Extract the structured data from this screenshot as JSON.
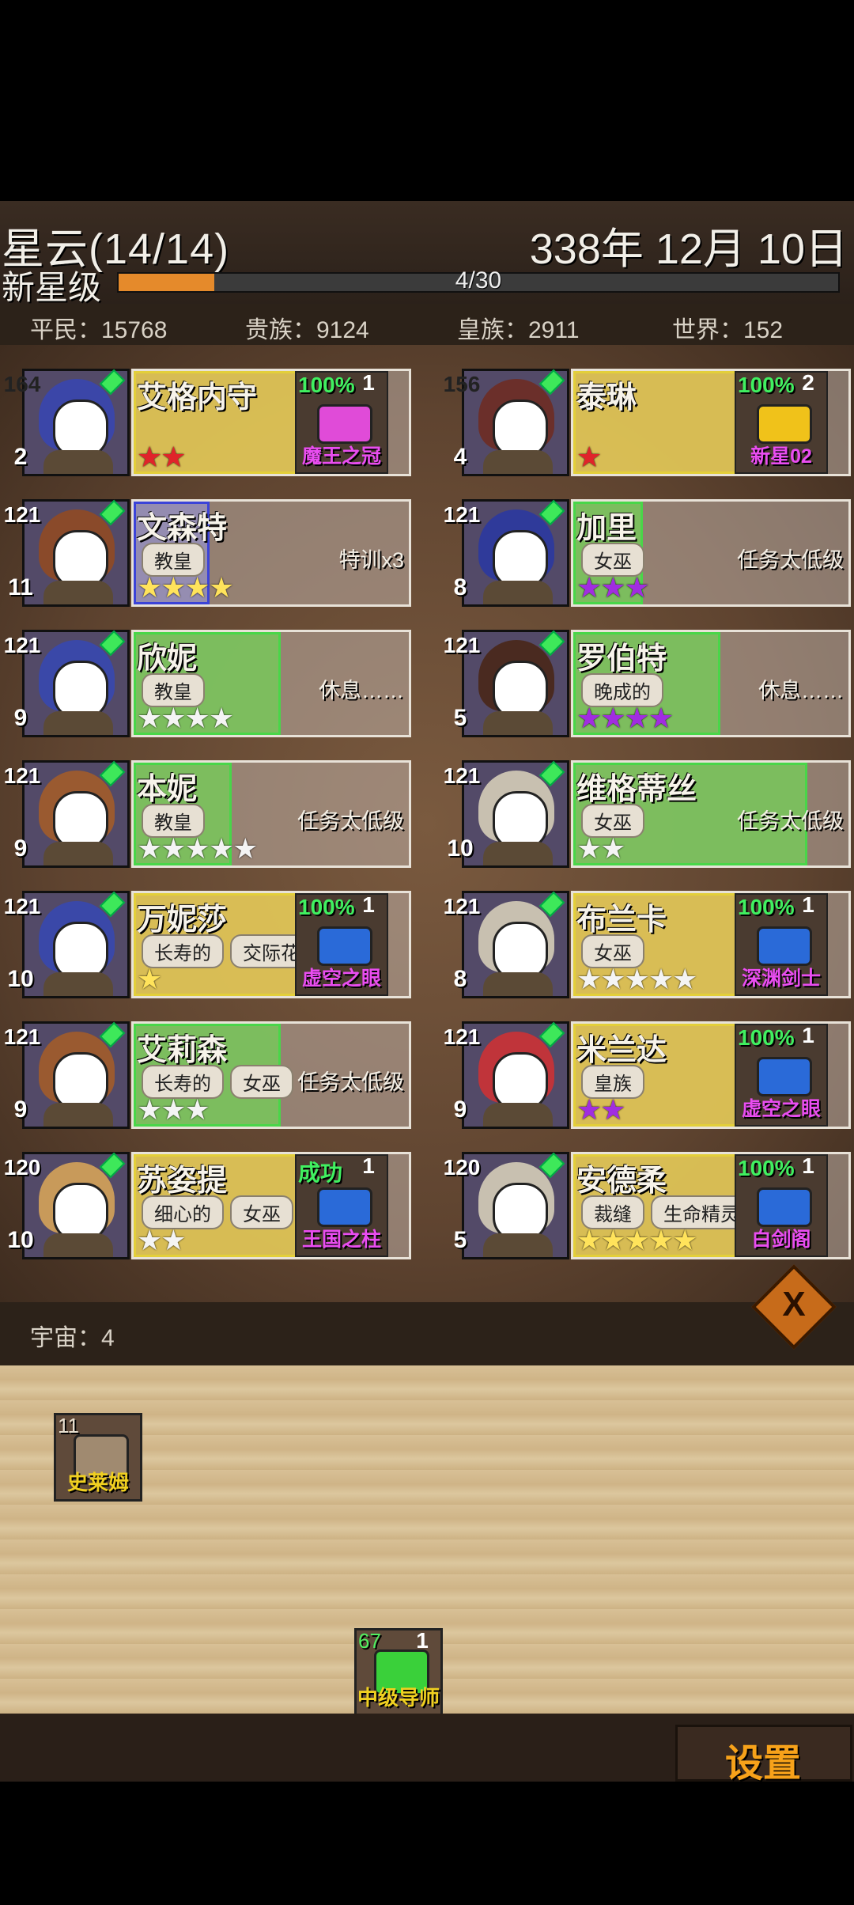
{
  "header": {
    "title": "星云(14/14)",
    "date": "338年 12月 10日",
    "rank": "新星级",
    "progress_text": "4/30",
    "progress_fraction": 0.133
  },
  "stats": [
    {
      "label": "平民：15768"
    },
    {
      "label": "贵族：9124"
    },
    {
      "label": "皇族：2911"
    },
    {
      "label": "世界：152"
    }
  ],
  "cards": [
    {
      "level": "164",
      "level_style": "gold",
      "name": "艾格内守",
      "hearts": "2",
      "highlight": "yellow",
      "tags": [],
      "stars": "★★",
      "star_color": "red",
      "status": "",
      "item": {
        "pct": "100%",
        "label": "魔王之冠",
        "count": "1",
        "color": "#e04bd8",
        "label_color": "#e94df0"
      },
      "hair": "#3b46a8"
    },
    {
      "level": "156",
      "level_style": "gold",
      "name": "泰琳",
      "hearts": "4",
      "highlight": "yellow",
      "tags": [],
      "stars": "★",
      "star_color": "red",
      "status": "",
      "item": {
        "pct": "100%",
        "label": "新星02",
        "count": "2",
        "color": "#f0c21a",
        "label_color": "#e94df0"
      },
      "hair": "#6b2f2a"
    },
    {
      "level": "121",
      "level_style": "pink",
      "name": "文森特",
      "hearts": "11",
      "highlight": "blue",
      "tags": [
        "教皇"
      ],
      "stars": "★★★★",
      "star_color": "yellow",
      "status": "特训x3",
      "item": null,
      "hair": "#8a4a2a"
    },
    {
      "level": "121",
      "level_style": "pink",
      "name": "加里",
      "hearts": "8",
      "highlight": "green",
      "tags": [
        "女巫"
      ],
      "stars": "★★★",
      "star_color": "purple",
      "status": "任务太低级",
      "item": null,
      "hair": "#2f3a9a"
    },
    {
      "level": "121",
      "level_style": "pink",
      "name": "欣妮",
      "hearts": "9",
      "highlight": "green",
      "tags": [
        "教皇"
      ],
      "stars": "★★★★",
      "star_color": "white",
      "status": "休息……",
      "item": null,
      "hair": "#3a48a8"
    },
    {
      "level": "121",
      "level_style": "pink",
      "name": "罗伯特",
      "hearts": "5",
      "highlight": "green",
      "tags": [
        "晚成的"
      ],
      "stars": "★★★★",
      "star_color": "purple",
      "status": "休息……",
      "item": null,
      "hair": "#4a2a20"
    },
    {
      "level": "121",
      "level_style": "pink",
      "name": "本妮",
      "hearts": "9",
      "highlight": "green",
      "tags": [
        "教皇"
      ],
      "stars": "★★★★★",
      "star_color": "white",
      "status": "任务太低级",
      "item": null,
      "hair": "#9a5a30"
    },
    {
      "level": "121",
      "level_style": "pink",
      "name": "维格蒂丝",
      "hearts": "10",
      "highlight": "green",
      "tags": [
        "女巫"
      ],
      "stars": "★★",
      "star_color": "white",
      "status": "任务太低级",
      "item": null,
      "hair": "#c8c0b0"
    },
    {
      "level": "121",
      "level_style": "pink",
      "name": "万妮莎",
      "hearts": "10",
      "highlight": "yellow",
      "tags": [
        "长寿的",
        "交际花"
      ],
      "stars": "★",
      "star_color": "yellow",
      "status": "",
      "item": {
        "pct": "100%",
        "label": "虚空之眼",
        "count": "1",
        "color": "#2a6ad8",
        "label_color": "#e94df0"
      },
      "hair": "#3a48a8"
    },
    {
      "level": "121",
      "level_style": "pink",
      "name": "布兰卡",
      "hearts": "8",
      "highlight": "yellow",
      "tags": [
        "女巫"
      ],
      "stars": "★★★★★",
      "star_color": "white",
      "status": "",
      "item": {
        "pct": "100%",
        "label": "深渊剑士",
        "count": "1",
        "color": "#2a6ad8",
        "label_color": "#e94df0"
      },
      "hair": "#c8c0b0"
    },
    {
      "level": "121",
      "level_style": "pink",
      "name": "艾莉森",
      "hearts": "9",
      "highlight": "green",
      "tags": [
        "长寿的",
        "女巫"
      ],
      "stars": "★★★",
      "star_color": "white",
      "status": "任务太低级",
      "item": null,
      "hair": "#9a5a30"
    },
    {
      "level": "121",
      "level_style": "pink",
      "name": "米兰达",
      "hearts": "9",
      "highlight": "yellow",
      "tags": [
        "皇族"
      ],
      "stars": "★★",
      "star_color": "purple",
      "status": "",
      "item": {
        "pct": "100%",
        "label": "虚空之眼",
        "count": "1",
        "color": "#2a6ad8",
        "label_color": "#e94df0"
      },
      "hair": "#c0343a"
    },
    {
      "level": "120",
      "level_style": "pink",
      "name": "苏姿提",
      "hearts": "10",
      "highlight": "yellow",
      "tags": [
        "细心的",
        "女巫"
      ],
      "stars": "★★",
      "star_color": "white",
      "status": "",
      "item": {
        "pct": "成功",
        "label": "王国之柱",
        "count": "1",
        "color": "#2a6ad8",
        "label_color": "#e94df0"
      },
      "hair": "#c89a5a"
    },
    {
      "level": "120",
      "level_style": "pink",
      "name": "安德柔",
      "hearts": "5",
      "highlight": "yellow",
      "tags": [
        "裁缝",
        "生命精灵"
      ],
      "stars": "★★★★★",
      "star_color": "yellow",
      "status": "",
      "item": {
        "pct": "100%",
        "label": "白剑阁",
        "count": "1",
        "color": "#2a6ad8",
        "label_color": "#e94df0"
      },
      "hair": "#c8c0b0"
    }
  ],
  "universe": {
    "label": "宇宙：4"
  },
  "floor_items": [
    {
      "count": "11",
      "label": "史莱姆",
      "color": "#a08a70"
    },
    {
      "count": "67",
      "label": "中级导师",
      "badge": "1",
      "color": "#3ad03a"
    }
  ],
  "settings_label": "设置"
}
